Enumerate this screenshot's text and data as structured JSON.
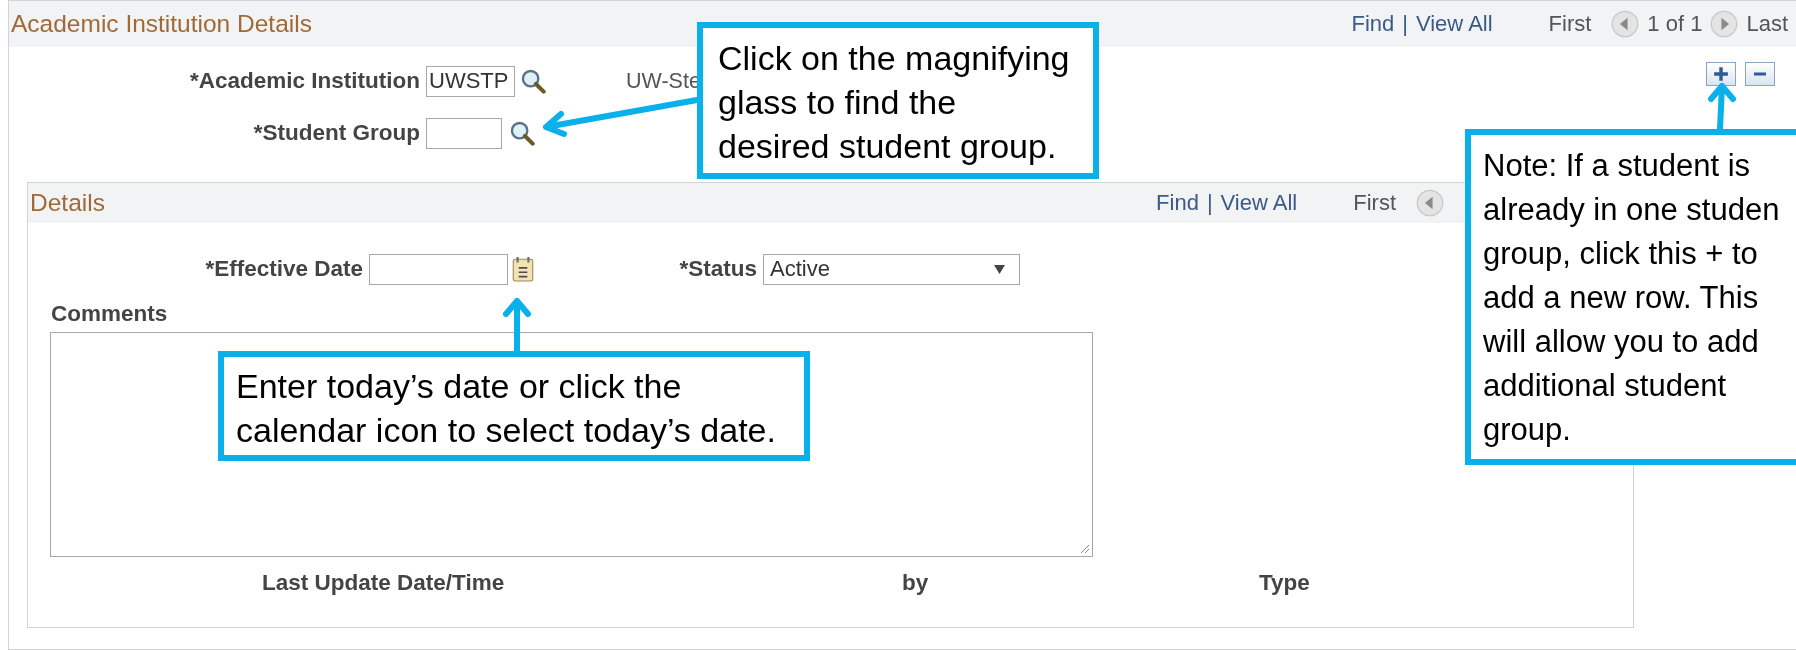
{
  "section": {
    "title": "Academic Institution Details",
    "nav": {
      "find": "Find",
      "separator": "|",
      "view_all": "View All",
      "first": "First",
      "count": "1 of 1",
      "last": "Last"
    }
  },
  "fields": [
    {
      "label": "*Academic Institution",
      "value": "UWSTP",
      "description": "UW-Ste"
    },
    {
      "label": "*Student Group"
    }
  ],
  "details": {
    "title": "Details",
    "nav": {
      "find": "Find",
      "separator": "|",
      "view_all": "View All",
      "first": "First"
    },
    "effective_date": {
      "label": "*Effective Date"
    },
    "status": {
      "label": "*Status",
      "value": "Active"
    },
    "comments": {
      "label": "Comments"
    },
    "footer": [
      "Last Update Date/Time",
      "by",
      "Type"
    ]
  },
  "callouts": [
    {
      "text": "Click on the magnifying\nglass to find the\ndesired student group."
    },
    {
      "text": "Enter today’s date or click the\ncalendar icon to select today’s date."
    },
    {
      "text": "Note: If a student is\nalready in one studen\ngroup, click this + to\nadd a new row. This\nwill allow you to add\nadditional student\ngroup."
    }
  ]
}
